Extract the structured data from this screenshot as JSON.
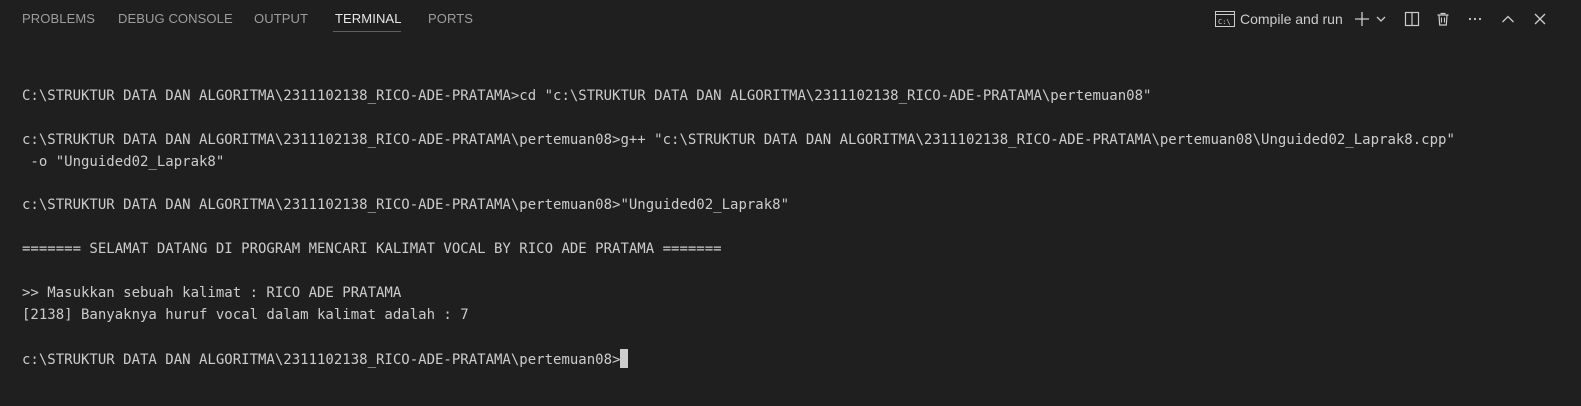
{
  "tabs": [
    {
      "label": "PROBLEMS",
      "active": false
    },
    {
      "label": "DEBUG CONSOLE",
      "active": false
    },
    {
      "label": "OUTPUT",
      "active": false
    },
    {
      "label": "TERMINAL",
      "active": true
    },
    {
      "label": "PORTS",
      "active": false
    }
  ],
  "actions": {
    "compile_icon": "terminal-cmd-icon",
    "compile_label": "Compile and run",
    "new_terminal_icon": "plus-icon",
    "dropdown_icon": "chevron-down-icon",
    "split_icon": "split-editor-icon",
    "trash_icon": "trash-icon",
    "more_icon": "ellipsis-icon",
    "maximize_icon": "chevron-up-icon",
    "close_icon": "close-icon"
  },
  "colors": {
    "background": "#1f1f1f",
    "active_tab_underline": "#0078d4",
    "text": "#cccccc"
  },
  "terminal": {
    "lines": [
      "",
      "C:\\STRUKTUR DATA DAN ALGORITMA\\2311102138_RICO-ADE-PRATAMA>cd \"c:\\STRUKTUR DATA DAN ALGORITMA\\2311102138_RICO-ADE-PRATAMA\\pertemuan08\"",
      "",
      "c:\\STRUKTUR DATA DAN ALGORITMA\\2311102138_RICO-ADE-PRATAMA\\pertemuan08>g++ \"c:\\STRUKTUR DATA DAN ALGORITMA\\2311102138_RICO-ADE-PRATAMA\\pertemuan08\\Unguided02_Laprak8.cpp\"",
      " -o \"Unguided02_Laprak8\"",
      "",
      "c:\\STRUKTUR DATA DAN ALGORITMA\\2311102138_RICO-ADE-PRATAMA\\pertemuan08>\"Unguided02_Laprak8\"",
      "",
      "======= SELAMAT DATANG DI PROGRAM MENCARI KALIMAT VOCAL BY RICO ADE PRATAMA =======",
      "",
      ">> Masukkan sebuah kalimat : RICO ADE PRATAMA",
      "[2138] Banyaknya huruf vocal dalam kalimat adalah : 7",
      "",
      "c:\\STRUKTUR DATA DAN ALGORITMA\\2311102138_RICO-ADE-PRATAMA\\pertemuan08>"
    ]
  }
}
